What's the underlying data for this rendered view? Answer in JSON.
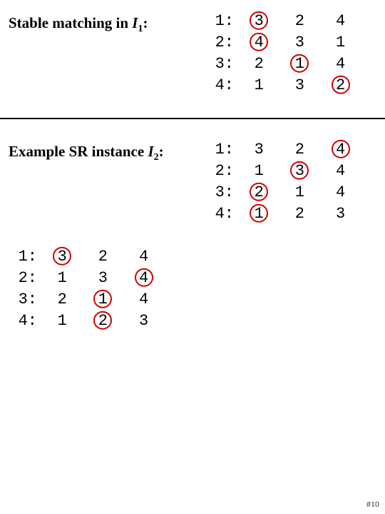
{
  "heading1": {
    "prefix": "Stable matching in ",
    "var": "I",
    "sub": "1",
    "suffix": ":"
  },
  "heading2": {
    "prefix": "Example SR instance ",
    "var": "I",
    "sub": "2",
    "suffix": ":"
  },
  "pagenum": "#10",
  "table1": {
    "rows": [
      {
        "label": "1:",
        "prefs": [
          "3",
          "2",
          "4"
        ],
        "circles": [
          "red",
          null,
          null
        ]
      },
      {
        "label": "2:",
        "prefs": [
          "4",
          "3",
          "1"
        ],
        "circles": [
          "red",
          null,
          null
        ]
      },
      {
        "label": "3:",
        "prefs": [
          "2",
          "1",
          "4"
        ],
        "circles": [
          null,
          "red",
          null
        ]
      },
      {
        "label": "4:",
        "prefs": [
          "1",
          "3",
          "2"
        ],
        "circles": [
          null,
          null,
          "red"
        ]
      }
    ]
  },
  "table2": {
    "rows": [
      {
        "label": "1:",
        "prefs": [
          "3",
          "2",
          "4"
        ],
        "circles": [
          null,
          null,
          "red"
        ]
      },
      {
        "label": "2:",
        "prefs": [
          "1",
          "3",
          "4"
        ],
        "circles": [
          null,
          "red",
          null
        ]
      },
      {
        "label": "3:",
        "prefs": [
          "2",
          "1",
          "4"
        ],
        "circles": [
          "red",
          null,
          null
        ]
      },
      {
        "label": "4:",
        "prefs": [
          "1",
          "2",
          "3"
        ],
        "circles": [
          "red",
          null,
          null
        ]
      }
    ]
  },
  "table3": {
    "rows": [
      {
        "label": "1:",
        "prefs": [
          "3",
          "2",
          "4"
        ],
        "circles": [
          "red",
          null,
          null
        ]
      },
      {
        "label": "2:",
        "prefs": [
          "1",
          "3",
          "4"
        ],
        "circles": [
          null,
          null,
          "red"
        ]
      },
      {
        "label": "3:",
        "prefs": [
          "2",
          "1",
          "4"
        ],
        "circles": [
          null,
          "red",
          null
        ]
      },
      {
        "label": "4:",
        "prefs": [
          "1",
          "2",
          "3"
        ],
        "circles": [
          null,
          "red",
          null
        ]
      }
    ]
  },
  "chart_data": [
    {
      "type": "table",
      "title": "Stable matching in I1",
      "agents": [
        1,
        2,
        3,
        4
      ],
      "preferences": {
        "1": [
          3,
          2,
          4
        ],
        "2": [
          4,
          3,
          1
        ],
        "3": [
          2,
          1,
          4
        ],
        "4": [
          1,
          3,
          2
        ]
      },
      "matching": {
        "1": 3,
        "2": 4,
        "3": 1,
        "4": 2
      },
      "highlight_color": "red"
    },
    {
      "type": "table",
      "title": "Example SR instance I2 (matching A)",
      "agents": [
        1,
        2,
        3,
        4
      ],
      "preferences": {
        "1": [
          3,
          2,
          4
        ],
        "2": [
          1,
          3,
          4
        ],
        "3": [
          2,
          1,
          4
        ],
        "4": [
          1,
          2,
          3
        ]
      },
      "matching": {
        "1": 4,
        "2": 3,
        "3": 2,
        "4": 1
      },
      "highlight_color": "red"
    },
    {
      "type": "table",
      "title": "Example SR instance I2 (matching B, bottom-left)",
      "agents": [
        1,
        2,
        3,
        4
      ],
      "preferences": {
        "1": [
          3,
          2,
          4
        ],
        "2": [
          1,
          3,
          4
        ],
        "3": [
          2,
          1,
          4
        ],
        "4": [
          1,
          2,
          3
        ]
      },
      "matching": {
        "1": 3,
        "2": 4,
        "3": 1,
        "4": 2
      },
      "highlight_color": "red"
    }
  ]
}
